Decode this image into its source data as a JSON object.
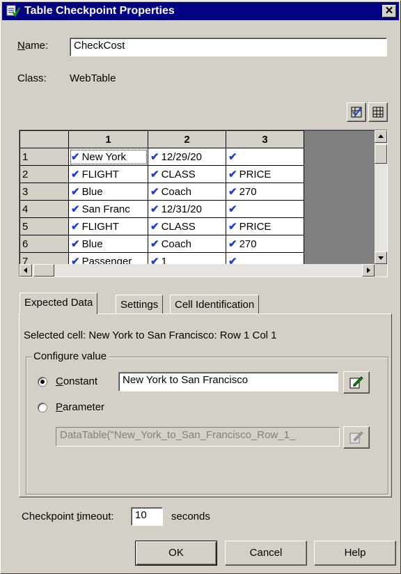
{
  "window": {
    "title": "Table Checkpoint Properties",
    "close_label": "✕"
  },
  "name_field": {
    "label": "Name:",
    "value": "CheckCost"
  },
  "class_field": {
    "label": "Class:",
    "value": "WebTable"
  },
  "grid": {
    "columns": [
      "1",
      "2",
      "3"
    ],
    "rows": [
      {
        "num": "1",
        "cells": [
          "New York",
          "12/29/20",
          ""
        ]
      },
      {
        "num": "2",
        "cells": [
          "FLIGHT",
          "CLASS",
          "PRICE"
        ]
      },
      {
        "num": "3",
        "cells": [
          "Blue",
          "Coach",
          "270"
        ]
      },
      {
        "num": "4",
        "cells": [
          "San Franc",
          "12/31/20",
          ""
        ]
      },
      {
        "num": "5",
        "cells": [
          "FLIGHT",
          "CLASS",
          "PRICE"
        ]
      },
      {
        "num": "6",
        "cells": [
          "Blue",
          "Coach",
          "270"
        ]
      },
      {
        "num": "7",
        "cells": [
          "Passenger",
          "1",
          ""
        ]
      }
    ]
  },
  "tabs": [
    "Expected Data",
    "Settings",
    "Cell Identification"
  ],
  "expected": {
    "selected_cell": "Selected cell: New York to San Francisco: Row 1 Col 1",
    "group_label": "Configure value",
    "constant_label": "Constant",
    "constant_value": "New York to San Francisco",
    "parameter_label": "Parameter",
    "parameter_value": "DataTable(\"New_York_to_San_Francisco_Row_1_"
  },
  "timeout": {
    "label": "Checkpoint timeout:",
    "value": "10",
    "unit": "seconds"
  },
  "buttons": {
    "ok": "OK",
    "cancel": "Cancel",
    "help": "Help"
  },
  "colors": {
    "title_bar": "#000080",
    "checkmark": "#1a3fd4",
    "face": "#d4d0c8"
  }
}
